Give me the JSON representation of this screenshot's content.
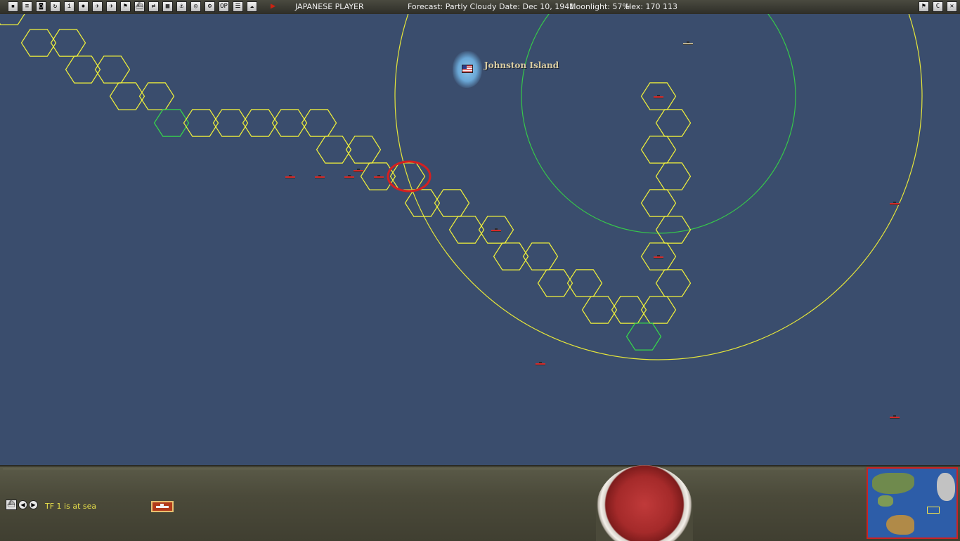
{
  "toolbar": {
    "buttons": [
      {
        "icon": "menu-icon",
        "glyph": "▪"
      },
      {
        "icon": "report-icon",
        "glyph": "≡"
      },
      {
        "icon": "cycle-icon",
        "glyph": "◙"
      },
      {
        "icon": "refresh-icon",
        "glyph": "↻"
      },
      {
        "icon": "info-icon",
        "glyph": "i"
      },
      {
        "icon": "rising-sun-icon",
        "glyph": "✹"
      },
      {
        "icon": "air-unit-icon",
        "glyph": "✈"
      },
      {
        "icon": "aircraft-icon",
        "glyph": "✈"
      },
      {
        "icon": "flag-icon",
        "glyph": "⚑"
      },
      {
        "icon": "ship-icon",
        "glyph": "⛴"
      },
      {
        "icon": "transfer-icon",
        "glyph": "⇄"
      },
      {
        "icon": "ground-unit-icon",
        "glyph": "▦"
      },
      {
        "icon": "port-icon",
        "glyph": "⚓"
      },
      {
        "icon": "globe-icon",
        "glyph": "◎"
      },
      {
        "icon": "settings-icon",
        "glyph": "⚙"
      },
      {
        "icon": "op-icon",
        "glyph": "OP"
      },
      {
        "icon": "list-icon",
        "glyph": "☰"
      },
      {
        "icon": "weather-icon",
        "glyph": "☁"
      },
      {
        "icon": "end-turn-play-icon",
        "glyph": "▶"
      }
    ],
    "player": "JAPANESE PLAYER",
    "forecast": "Forecast: Partly Cloudy",
    "date": "Date: Dec 10, 1941",
    "moonlight": "Moonlight: 57%",
    "hex": "Hex: 170 113",
    "right_buttons": [
      {
        "icon": "flag-toggle-icon",
        "glyph": "⚑"
      },
      {
        "icon": "c-icon",
        "glyph": "C"
      },
      {
        "icon": "close-icon",
        "glyph": "✕"
      }
    ]
  },
  "map": {
    "location_name": "Johnston Island",
    "hex_color": "#f2f23a",
    "hex_highlight_color": "#36d84a",
    "range_circle_outer_color": "#e6e63a",
    "range_circle_inner_color": "#36c84a",
    "selection_marker_color": "#d42020"
  },
  "bottom_panel": {
    "status_text": "TF 1 is at sea"
  }
}
